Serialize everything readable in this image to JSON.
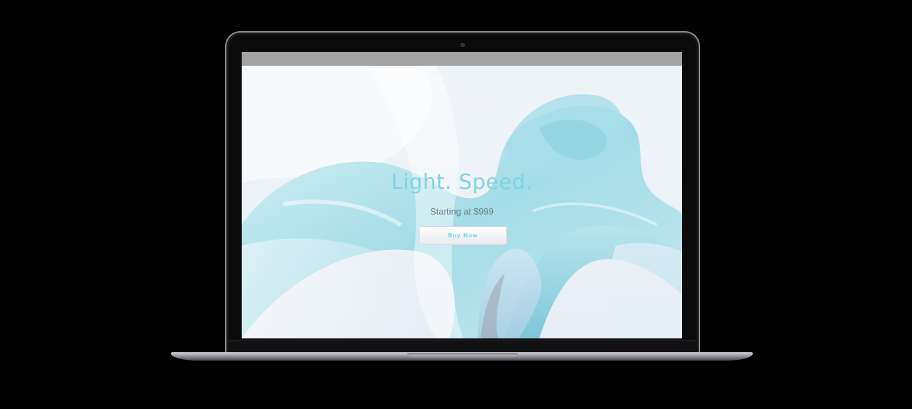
{
  "hero": {
    "title": "Light. Speed.",
    "subtitle": "Starting at $999",
    "buy_button_label": "Buy Now"
  },
  "colors": {
    "accent": "#7fd3e2",
    "subtitle": "#6c7a83",
    "browser_bar": "#a3a3a3",
    "background": "#000000"
  }
}
